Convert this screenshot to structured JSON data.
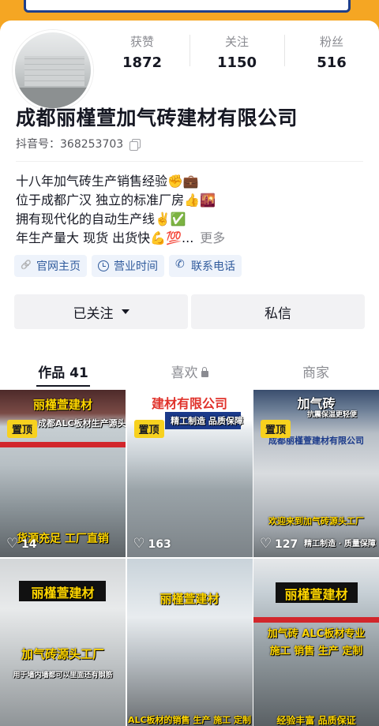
{
  "profile": {
    "avatar_icon": "factory-warehouse-photo",
    "stats": [
      {
        "label": "获赞",
        "value": "1872"
      },
      {
        "label": "关注",
        "value": "1150"
      },
      {
        "label": "粉丝",
        "value": "516"
      }
    ],
    "name": "成都丽槿萱加气砖建材有限公司",
    "douyin_id": "抖音号：368253703",
    "bio": [
      "十八年加气砖生产销售经验✊💼",
      "位于成都广汉 独立的标准厂房👍🌇",
      "拥有现代化的自动生产线✌️✅",
      "年生产量大 现货 出货快💪💯..."
    ],
    "more_label": "更多",
    "chips": [
      {
        "label": "官网主页",
        "icon": "link-icon"
      },
      {
        "label": "营业时间",
        "icon": "clock-icon"
      },
      {
        "label": "联系电话",
        "icon": "phone-icon"
      }
    ],
    "follow_label": "已关注",
    "message_label": "私信"
  },
  "tabs": [
    {
      "label": "作品 41",
      "active": true
    },
    {
      "label": "喜欢",
      "active": false,
      "icon": "lock-icon"
    },
    {
      "label": "商家",
      "active": false
    }
  ],
  "videos": [
    {
      "pin": "置顶",
      "top_text": "丽槿萱建材",
      "sub_text": "成都ALC板材生产源头厂家",
      "bottom_text": "货源充足 工厂直销",
      "likes": "14"
    },
    {
      "pin": "置顶",
      "top_text": "建材有限公司",
      "sub_text": "精工制造 品质保障",
      "likes": "163"
    },
    {
      "pin": "置顶",
      "top_text": "加气砖",
      "sub_text": "抗震保温更轻便",
      "mid_text": "成都丽槿萱建材有限公司",
      "bottom_text": "欢迎来到加气砖源头工厂",
      "foot_text": "精工制造 · 质量保障",
      "likes": "127"
    },
    {
      "top_text": "丽槿萱建材",
      "bottom_text": "加气砖源头工厂",
      "foot_text": "用于墙内墙都可以里面还有钢筋"
    },
    {
      "top_text": "丽槿萱建材",
      "bottom_text": "ALC板材的销售 生产 施工 定制"
    },
    {
      "top_text": "丽槿萱建材",
      "sub_text": "加气砖 ALC板材专业",
      "mid_text": "施工 销售 生产 定制",
      "bottom_text": "经验丰富 品质保证"
    }
  ],
  "colors": {
    "accent_chip": "#2f5a9c",
    "pin_bg": "#f7d11e",
    "banner": "#f5a623"
  }
}
